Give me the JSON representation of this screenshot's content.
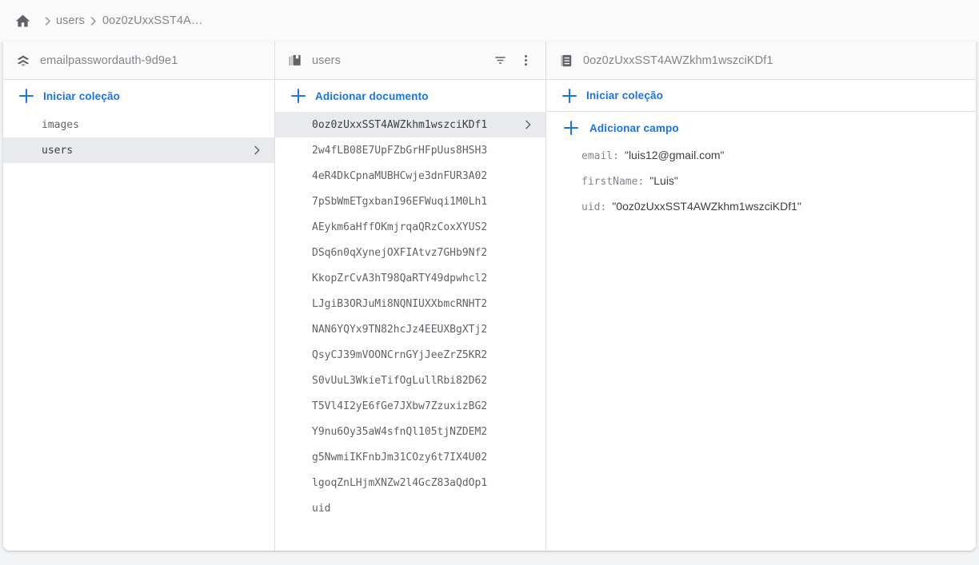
{
  "breadcrumb": {
    "home_icon": "home-icon",
    "separator": "chevron-right-icon",
    "items": [
      "users",
      "0oz0zUxxSST4A…"
    ]
  },
  "left_panel": {
    "header": {
      "icon": "firestore-database-icon",
      "title": "emailpasswordauth-9d9e1"
    },
    "start_collection_label": "Iniciar coleção",
    "collections": [
      {
        "name": "images",
        "selected": false
      },
      {
        "name": "users",
        "selected": true
      }
    ]
  },
  "middle_panel": {
    "header": {
      "icon": "collection-icon",
      "title": "users",
      "filter_icon": "filter-icon",
      "menu_icon": "more-vert-icon"
    },
    "add_document_label": "Adicionar documento",
    "documents": [
      {
        "id": "0oz0zUxxSST4AWZkhm1wszciKDf1",
        "selected": true
      },
      {
        "id": "2w4fLB08E7UpFZbGrHFpUus8HSH3",
        "selected": false
      },
      {
        "id": "4eR4DkCpnaMUBHCwje3dnFUR3A02",
        "selected": false
      },
      {
        "id": "7pSbWmETgxbanI96EFWuqi1M0Lh1",
        "selected": false
      },
      {
        "id": "AEykm6aHffOKmjrqaQRzCoxXYUS2",
        "selected": false
      },
      {
        "id": "DSq6n0qXynejOXFIAtvz7GHb9Nf2",
        "selected": false
      },
      {
        "id": "KkopZrCvA3hT98QaRTY49dpwhcl2",
        "selected": false
      },
      {
        "id": "LJgiB3ORJuMi8NQNIUXXbmcRNHT2",
        "selected": false
      },
      {
        "id": "NAN6YQYx9TN82hcJz4EEUXBgXTj2",
        "selected": false
      },
      {
        "id": "QsyCJ39mVOONCrnGYjJeeZrZ5KR2",
        "selected": false
      },
      {
        "id": "S0vUuL3WkieTifOgLullRbi82D62",
        "selected": false
      },
      {
        "id": "T5Vl4I2yE6fGe7JXbw7ZzuxizBG2",
        "selected": false
      },
      {
        "id": "Y9nu6Oy35aW4sfnQl105tjNZDEM2",
        "selected": false
      },
      {
        "id": "g5NwmiIKFnbJm31COzy6t7IX4U02",
        "selected": false
      },
      {
        "id": "lgoqZnLHjmXNZw2l4GcZ83aQdOp1",
        "selected": false
      },
      {
        "id": "uid",
        "selected": false
      }
    ]
  },
  "right_panel": {
    "header": {
      "icon": "document-icon",
      "title": "0oz0zUxxSST4AWZkhm1wszciKDf1"
    },
    "start_collection_label": "Iniciar coleção",
    "add_field_label": "Adicionar campo",
    "fields": [
      {
        "key": "email:",
        "value": "\"luis12@gmail.com\""
      },
      {
        "key": "firstName:",
        "value": "\"Luis\""
      },
      {
        "key": "uid:",
        "value": "\"0oz0zUxxSST4AWZkhm1wszciKDf1\""
      }
    ]
  },
  "colors": {
    "accent": "#1a73e8",
    "text_muted": "#80868b",
    "text_primary": "#3c4043",
    "selected_row": "#e8eaed",
    "page_bg": "#f1f3f4"
  }
}
